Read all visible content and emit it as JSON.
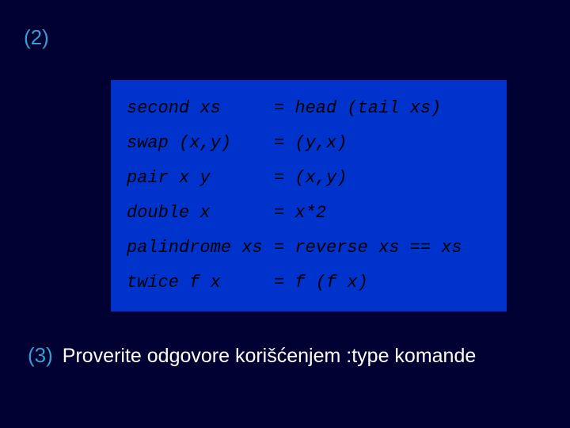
{
  "markers": {
    "item2": "(2)",
    "item3": "(3)"
  },
  "code": {
    "rows": [
      {
        "lhs": "second xs",
        "rhs": "= head (tail xs)"
      },
      {
        "lhs": "swap (x,y)",
        "rhs": "= (y,x)"
      },
      {
        "lhs": "pair x y",
        "rhs": "= (x,y)"
      },
      {
        "lhs": "double x",
        "rhs": "= x*2"
      },
      {
        "lhs": "palindrome xs",
        "rhs": "= reverse xs == xs"
      },
      {
        "lhs": "twice f x",
        "rhs": "= f (f x)"
      }
    ]
  },
  "item3_text": "Proverite odgovore korišćenjem :type komande"
}
